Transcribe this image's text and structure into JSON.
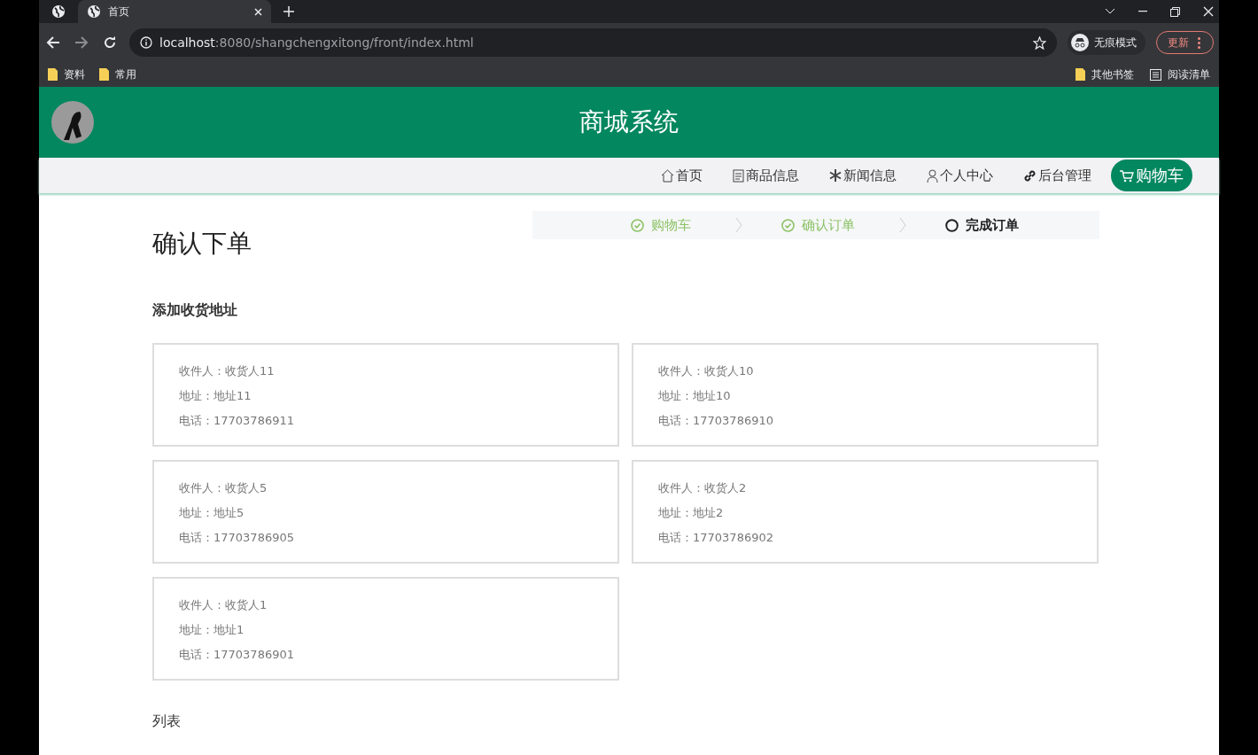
{
  "browser": {
    "tabs": [
      {
        "title": "首页",
        "selected": true
      }
    ],
    "url_host": "localhost",
    "url_rest": ":8080/shangchengxitong/front/index.html",
    "profile": "无痕模式",
    "update_button": "更新",
    "bookmarks": [
      "资料",
      "常用"
    ],
    "bookmarks_right": [
      {
        "label": "其他书签",
        "kind": "folder"
      },
      {
        "label": "阅读清单",
        "kind": "list"
      }
    ]
  },
  "site": {
    "title": "商城系统",
    "nav": [
      {
        "label": "首页",
        "kind": "home",
        "selected": false
      },
      {
        "label": "商品信息",
        "kind": "doc",
        "selected": false
      },
      {
        "label": "新闻信息",
        "kind": "snow",
        "selected": false
      },
      {
        "label": "个人中心",
        "kind": "user",
        "selected": false
      },
      {
        "label": "后台管理",
        "kind": "link",
        "selected": false
      },
      {
        "label": "购物车",
        "kind": "cart",
        "selected": true
      }
    ]
  },
  "page": {
    "title": "确认下单",
    "steps": [
      {
        "label": "购物车",
        "done": true
      },
      {
        "label": "确认订单",
        "done": true
      },
      {
        "label": "完成订单",
        "done": false
      }
    ],
    "address_heading": "添加收货地址",
    "addresses": [
      {
        "recipient": "收件人：收货人11",
        "address": "地址：地址11",
        "phone": "电话：17703786911"
      },
      {
        "recipient": "收件人：收货人10",
        "address": "地址：地址10",
        "phone": "电话：17703786910"
      },
      {
        "recipient": "收件人：收货人5",
        "address": "地址：地址5",
        "phone": "电话：17703786905"
      },
      {
        "recipient": "收件人：收货人2",
        "address": "地址：地址2",
        "phone": "电话：17703786902"
      },
      {
        "recipient": "收件人：收货人1",
        "address": "地址：地址1",
        "phone": "电话：17703786901"
      }
    ],
    "list_heading": "列表"
  }
}
